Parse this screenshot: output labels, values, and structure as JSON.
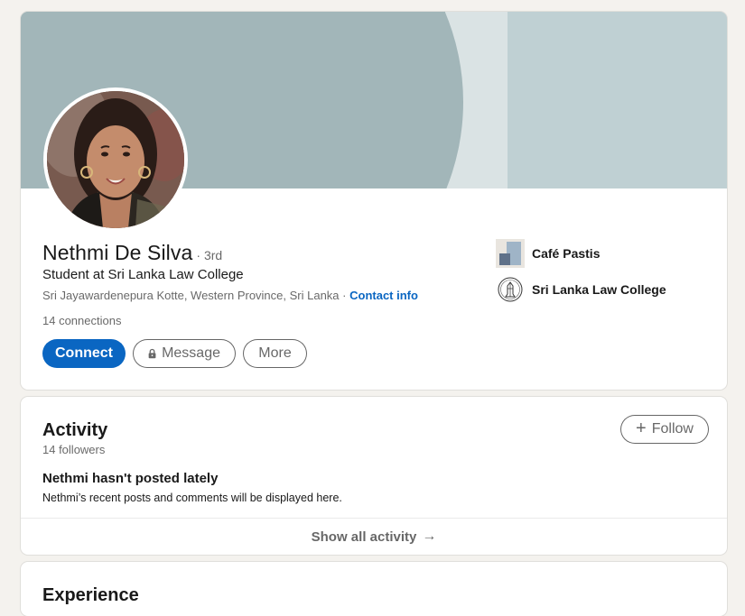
{
  "profile": {
    "name": "Nethmi De Silva",
    "degree": "· 3rd",
    "headline": "Student at Sri Lanka Law College",
    "location": "Sri Jayawardenepura Kotte, Western Province, Sri Lanka",
    "separator": " · ",
    "contact_info": "Contact info",
    "connections": "14 connections",
    "actions": {
      "connect": "Connect",
      "message": "Message",
      "more": "More"
    },
    "experience_items": [
      {
        "label": "Café Pastis",
        "icon": "company-logo"
      },
      {
        "label": "Sri Lanka Law College",
        "icon": "school-seal-logo"
      }
    ]
  },
  "activity": {
    "title": "Activity",
    "followers": "14 followers",
    "follow_label": "Follow",
    "empty_heading": "Nethmi hasn't posted lately",
    "empty_sub": "Nethmi’s recent posts and comments will be displayed here.",
    "show_all": "Show all activity"
  },
  "next_section": {
    "title": "Experience"
  },
  "colors": {
    "accent": "#0a66c2",
    "banner": "#a2b6b9",
    "background": "#f4f2ee"
  }
}
